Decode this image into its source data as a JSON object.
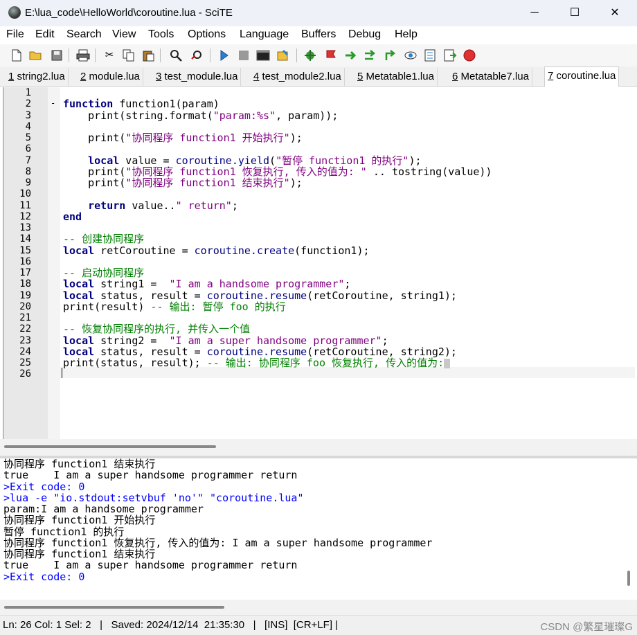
{
  "window": {
    "title": "E:\\lua_code\\HelloWorld\\coroutine.lua - SciTE",
    "minimize": "─",
    "maximize": "☐",
    "close": "✕"
  },
  "menu": [
    "File",
    "Edit",
    "Search",
    "View",
    "Tools",
    "Options",
    "Language",
    "Buffers",
    "Debug",
    "Help"
  ],
  "toolbar": {
    "icons": [
      "new-file-icon",
      "open-folder-icon",
      "save-icon",
      "print-icon",
      "cut-icon",
      "copy-icon",
      "paste-icon",
      "find-icon",
      "replace-icon",
      "compile-icon",
      "stop-icon",
      "terminal-icon",
      "build-icon",
      "debug-run-icon",
      "bookmark-flag-icon",
      "step-over-icon",
      "step-into-icon",
      "step-out-icon",
      "watch-icon",
      "breakpoints-icon",
      "call-stack-icon",
      "kill-icon"
    ]
  },
  "tabs": [
    {
      "num": "1",
      "name": " string2.lua"
    },
    {
      "num": "2",
      "name": " module.lua"
    },
    {
      "num": "3",
      "name": " test_module.lua"
    },
    {
      "num": "4",
      "name": " test_module2.lua"
    },
    {
      "num": "5",
      "name": " Metatable1.lua"
    },
    {
      "num": "6",
      "name": " Metatable7.lua"
    },
    {
      "num": "7",
      "name": " coroutine.lua"
    }
  ],
  "line_numbers": [
    "1",
    "2",
    "3",
    "4",
    "5",
    "6",
    "7",
    "8",
    "9",
    "10",
    "11",
    "12",
    "13",
    "14",
    "15",
    "16",
    "17",
    "18",
    "19",
    "20",
    "21",
    "22",
    "23",
    "24",
    "25",
    "26"
  ],
  "code": {
    "l2a": "function",
    "l2b": " function1(param)",
    "l3a": "    print(string.format(",
    "l3b": "\"param:%s\"",
    "l3c": ", param));",
    "l5a": "    print(",
    "l5b": "\"协同程序 function1 开始执行\"",
    "l5c": ");",
    "l7a": "    ",
    "l7b": "local",
    "l7c": " value = ",
    "l7d": "coroutine.yield",
    "l7e": "(",
    "l7f": "\"暂停 function1 的执行\"",
    "l7g": ");",
    "l8a": "    print(",
    "l8b": "\"协同程序 function1 恢复执行, 传入的值为: \"",
    "l8c": " .. tostring(value))",
    "l9a": "    print(",
    "l9b": "\"协同程序 function1 结束执行\"",
    "l9c": ");",
    "l11a": "    ",
    "l11b": "return",
    "l11c": " value..",
    "l11d": "\" return\"",
    "l11e": ";",
    "l12": "end",
    "l14": "-- 创建协同程序",
    "l15a": "local",
    "l15b": " retCoroutine = ",
    "l15c": "coroutine.create",
    "l15d": "(function1);",
    "l17": "-- 启动协同程序",
    "l18a": "local",
    "l18b": " string1 =  ",
    "l18c": "\"I am a handsome programmer\"",
    "l18d": ";",
    "l19a": "local",
    "l19b": " status, result = ",
    "l19c": "coroutine.resume",
    "l19d": "(retCoroutine, string1);",
    "l20a": "print(result) ",
    "l20b": "-- 输出: 暂停 foo 的执行",
    "l22": "-- 恢复协同程序的执行, 并传入一个值",
    "l23a": "local",
    "l23b": " string2 =  ",
    "l23c": "\"I am a super handsome programmer\"",
    "l23d": ";",
    "l24a": "local",
    "l24b": " status, result = ",
    "l24c": "coroutine.resume",
    "l24d": "(retCoroutine, string2);",
    "l25a": "print(status, result); ",
    "l25b": "-- 输出: 协同程序 foo 恢复执行, 传入的值为:"
  },
  "output": [
    {
      "text": "协同程序 function1 结束执行",
      "blue": false
    },
    {
      "text": "true    I am a super handsome programmer return",
      "blue": false
    },
    {
      "text": ">Exit code: 0",
      "blue": true
    },
    {
      "text": ">lua -e \"io.stdout:setvbuf 'no'\" \"coroutine.lua\"",
      "blue": true
    },
    {
      "text": "param:I am a handsome programmer",
      "blue": false
    },
    {
      "text": "协同程序 function1 开始执行",
      "blue": false
    },
    {
      "text": "暂停 function1 的执行",
      "blue": false
    },
    {
      "text": "协同程序 function1 恢复执行, 传入的值为: I am a super handsome programmer",
      "blue": false
    },
    {
      "text": "协同程序 function1 结束执行",
      "blue": false
    },
    {
      "text": "true    I am a super handsome programmer return",
      "blue": false
    },
    {
      "text": ">Exit code: 0",
      "blue": true
    }
  ],
  "status": {
    "text": "Ln: 26 Col: 1 Sel: 2   |   Saved: 2024/12/14  21:35:30   |   [INS]  [CR+LF] |",
    "watermark": "CSDN @繁星璀璨G"
  }
}
